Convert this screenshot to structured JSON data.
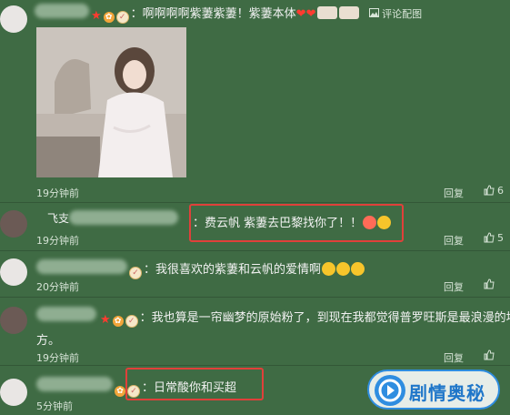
{
  "comments": [
    {
      "text": "：啊啊啊啊紫萋紫萋！紫萋本体",
      "pic_label": "评论配图",
      "time": "19分钟前",
      "reply": "回复",
      "likes": "6"
    },
    {
      "username_fragment": "飞支",
      "text": "：费云帆 紫萋去巴黎找你了！！",
      "time": "19分钟前",
      "reply": "回复",
      "likes": "5"
    },
    {
      "text": "：我很喜欢的紫萋和云帆的爱情啊",
      "time": "20分钟前",
      "reply": "回复",
      "likes": ""
    },
    {
      "text_line1": "：我也算是一帘幽梦的原始粉了，到现在我都觉得普罗旺斯是最浪漫的地",
      "text_line2": "方。",
      "time": "19分钟前",
      "reply": "回复",
      "likes": ""
    },
    {
      "text": "：日常酸你和买超",
      "time": "5分钟前",
      "reply": "回复",
      "likes": ""
    }
  ],
  "watermark": {
    "text": "剧情奥秘"
  },
  "colors": {
    "background": "#3f6b44",
    "highlight": "#e0403a",
    "watermark_blue": "#2f8de0"
  }
}
